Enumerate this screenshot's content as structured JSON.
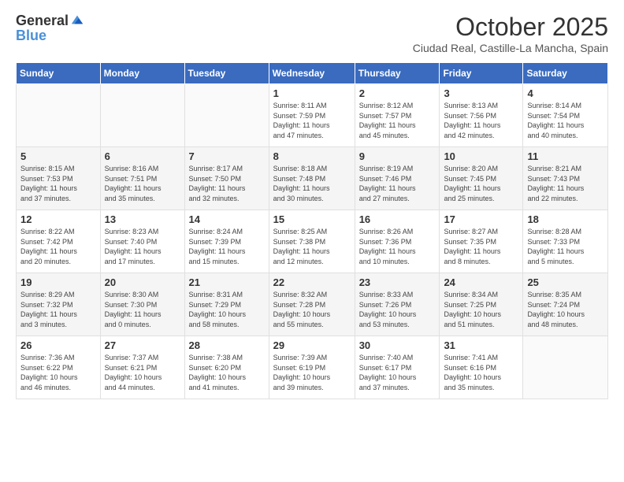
{
  "header": {
    "logo_general": "General",
    "logo_blue": "Blue",
    "month": "October 2025",
    "location": "Ciudad Real, Castille-La Mancha, Spain"
  },
  "days_of_week": [
    "Sunday",
    "Monday",
    "Tuesday",
    "Wednesday",
    "Thursday",
    "Friday",
    "Saturday"
  ],
  "weeks": [
    [
      {
        "day": "",
        "info": ""
      },
      {
        "day": "",
        "info": ""
      },
      {
        "day": "",
        "info": ""
      },
      {
        "day": "1",
        "info": "Sunrise: 8:11 AM\nSunset: 7:59 PM\nDaylight: 11 hours\nand 47 minutes."
      },
      {
        "day": "2",
        "info": "Sunrise: 8:12 AM\nSunset: 7:57 PM\nDaylight: 11 hours\nand 45 minutes."
      },
      {
        "day": "3",
        "info": "Sunrise: 8:13 AM\nSunset: 7:56 PM\nDaylight: 11 hours\nand 42 minutes."
      },
      {
        "day": "4",
        "info": "Sunrise: 8:14 AM\nSunset: 7:54 PM\nDaylight: 11 hours\nand 40 minutes."
      }
    ],
    [
      {
        "day": "5",
        "info": "Sunrise: 8:15 AM\nSunset: 7:53 PM\nDaylight: 11 hours\nand 37 minutes."
      },
      {
        "day": "6",
        "info": "Sunrise: 8:16 AM\nSunset: 7:51 PM\nDaylight: 11 hours\nand 35 minutes."
      },
      {
        "day": "7",
        "info": "Sunrise: 8:17 AM\nSunset: 7:50 PM\nDaylight: 11 hours\nand 32 minutes."
      },
      {
        "day": "8",
        "info": "Sunrise: 8:18 AM\nSunset: 7:48 PM\nDaylight: 11 hours\nand 30 minutes."
      },
      {
        "day": "9",
        "info": "Sunrise: 8:19 AM\nSunset: 7:46 PM\nDaylight: 11 hours\nand 27 minutes."
      },
      {
        "day": "10",
        "info": "Sunrise: 8:20 AM\nSunset: 7:45 PM\nDaylight: 11 hours\nand 25 minutes."
      },
      {
        "day": "11",
        "info": "Sunrise: 8:21 AM\nSunset: 7:43 PM\nDaylight: 11 hours\nand 22 minutes."
      }
    ],
    [
      {
        "day": "12",
        "info": "Sunrise: 8:22 AM\nSunset: 7:42 PM\nDaylight: 11 hours\nand 20 minutes."
      },
      {
        "day": "13",
        "info": "Sunrise: 8:23 AM\nSunset: 7:40 PM\nDaylight: 11 hours\nand 17 minutes."
      },
      {
        "day": "14",
        "info": "Sunrise: 8:24 AM\nSunset: 7:39 PM\nDaylight: 11 hours\nand 15 minutes."
      },
      {
        "day": "15",
        "info": "Sunrise: 8:25 AM\nSunset: 7:38 PM\nDaylight: 11 hours\nand 12 minutes."
      },
      {
        "day": "16",
        "info": "Sunrise: 8:26 AM\nSunset: 7:36 PM\nDaylight: 11 hours\nand 10 minutes."
      },
      {
        "day": "17",
        "info": "Sunrise: 8:27 AM\nSunset: 7:35 PM\nDaylight: 11 hours\nand 8 minutes."
      },
      {
        "day": "18",
        "info": "Sunrise: 8:28 AM\nSunset: 7:33 PM\nDaylight: 11 hours\nand 5 minutes."
      }
    ],
    [
      {
        "day": "19",
        "info": "Sunrise: 8:29 AM\nSunset: 7:32 PM\nDaylight: 11 hours\nand 3 minutes."
      },
      {
        "day": "20",
        "info": "Sunrise: 8:30 AM\nSunset: 7:30 PM\nDaylight: 11 hours\nand 0 minutes."
      },
      {
        "day": "21",
        "info": "Sunrise: 8:31 AM\nSunset: 7:29 PM\nDaylight: 10 hours\nand 58 minutes."
      },
      {
        "day": "22",
        "info": "Sunrise: 8:32 AM\nSunset: 7:28 PM\nDaylight: 10 hours\nand 55 minutes."
      },
      {
        "day": "23",
        "info": "Sunrise: 8:33 AM\nSunset: 7:26 PM\nDaylight: 10 hours\nand 53 minutes."
      },
      {
        "day": "24",
        "info": "Sunrise: 8:34 AM\nSunset: 7:25 PM\nDaylight: 10 hours\nand 51 minutes."
      },
      {
        "day": "25",
        "info": "Sunrise: 8:35 AM\nSunset: 7:24 PM\nDaylight: 10 hours\nand 48 minutes."
      }
    ],
    [
      {
        "day": "26",
        "info": "Sunrise: 7:36 AM\nSunset: 6:22 PM\nDaylight: 10 hours\nand 46 minutes."
      },
      {
        "day": "27",
        "info": "Sunrise: 7:37 AM\nSunset: 6:21 PM\nDaylight: 10 hours\nand 44 minutes."
      },
      {
        "day": "28",
        "info": "Sunrise: 7:38 AM\nSunset: 6:20 PM\nDaylight: 10 hours\nand 41 minutes."
      },
      {
        "day": "29",
        "info": "Sunrise: 7:39 AM\nSunset: 6:19 PM\nDaylight: 10 hours\nand 39 minutes."
      },
      {
        "day": "30",
        "info": "Sunrise: 7:40 AM\nSunset: 6:17 PM\nDaylight: 10 hours\nand 37 minutes."
      },
      {
        "day": "31",
        "info": "Sunrise: 7:41 AM\nSunset: 6:16 PM\nDaylight: 10 hours\nand 35 minutes."
      },
      {
        "day": "",
        "info": ""
      }
    ]
  ]
}
